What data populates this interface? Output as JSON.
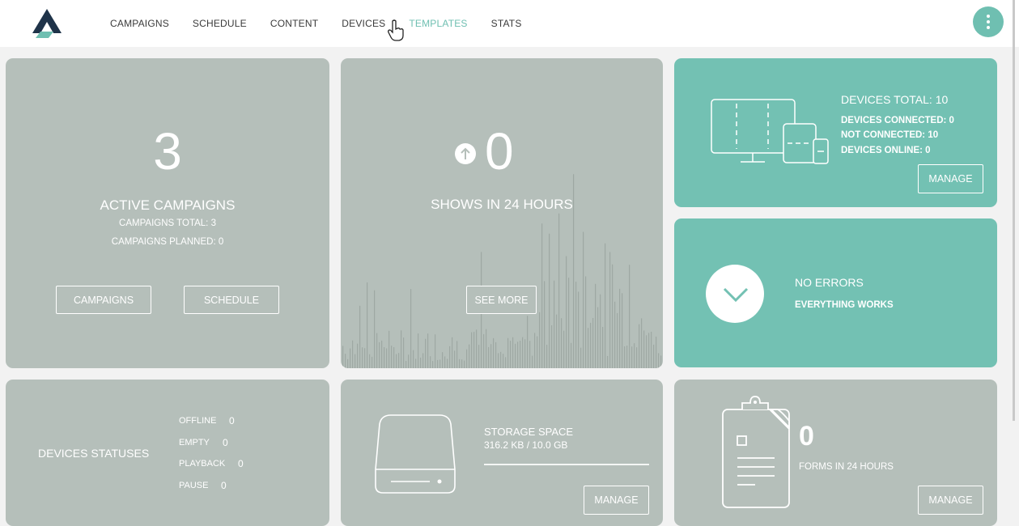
{
  "nav": {
    "items": [
      "CAMPAIGNS",
      "SCHEDULE",
      "CONTENT",
      "DEVICES",
      "TEMPLATES",
      "STATS"
    ],
    "active": "TEMPLATES"
  },
  "colors": {
    "accent": "#73c1b3",
    "card_gray": "#b5bfba",
    "nav_active": "#6fbfb1"
  },
  "campaigns_card": {
    "count": "3",
    "title": "ACTIVE CAMPAIGNS",
    "total": "CAMPAIGNS TOTAL: 3",
    "planned": "CAMPAIGNS PLANNED: 0",
    "btn_campaigns": "CAMPAIGNS",
    "btn_schedule": "SCHEDULE"
  },
  "shows_card": {
    "count": "0",
    "title": "SHOWS IN 24 HOURS",
    "btn_see_more": "SEE MORE",
    "trend_icon": "arrow-up-circle-icon"
  },
  "devices_card": {
    "title": "DEVICES TOTAL: 10",
    "connected": "DEVICES CONNECTED: 0",
    "not_connected": "NOT CONNECTED: 10",
    "online": "DEVICES ONLINE: 0",
    "btn_manage": "MANAGE"
  },
  "errors_card": {
    "title": "NO ERRORS",
    "subtitle": "EVERYTHING WORKS"
  },
  "statuses_card": {
    "title": "DEVICES STATUSES",
    "items": [
      {
        "label": "OFFLINE",
        "value": "0"
      },
      {
        "label": "EMPTY",
        "value": "0"
      },
      {
        "label": "PLAYBACK",
        "value": "0"
      },
      {
        "label": "PAUSE",
        "value": "0"
      }
    ]
  },
  "storage_card": {
    "title": "STORAGE SPACE",
    "usage": "316.2 KB / 10.0 GB",
    "used_fraction": 3e-05,
    "btn_manage": "MANAGE"
  },
  "forms_card": {
    "count": "0",
    "title": "FORMS IN 24 HOURS",
    "btn_manage": "MANAGE"
  }
}
